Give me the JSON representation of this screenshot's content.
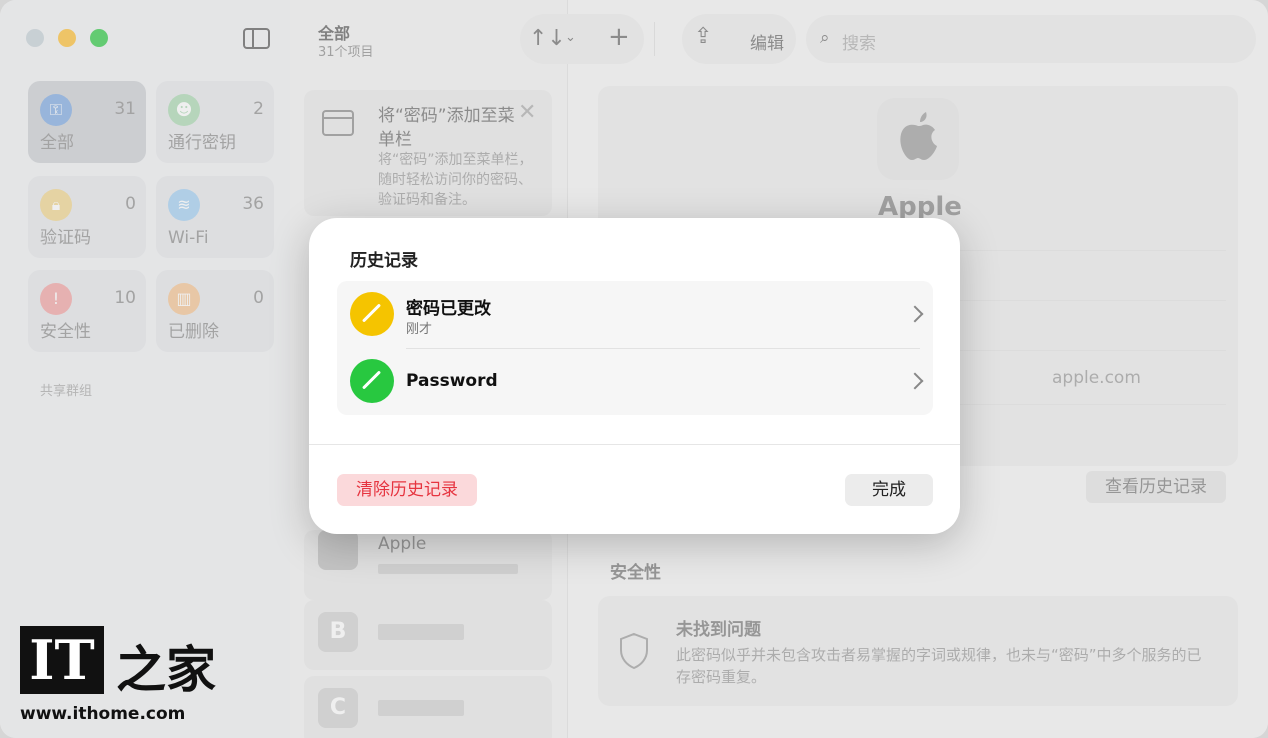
{
  "sidebar": {
    "tiles": [
      {
        "label": "全部",
        "count": "31",
        "color": "#1a73e8"
      },
      {
        "label": "通行密钥",
        "count": "2",
        "color": "#34c759"
      },
      {
        "label": "验证码",
        "count": "0",
        "color": "#f5b400"
      },
      {
        "label": "Wi-Fi",
        "count": "36",
        "color": "#2f9bf5"
      },
      {
        "label": "安全性",
        "count": "10",
        "color": "#ff3b30"
      },
      {
        "label": "已删除",
        "count": "0",
        "color": "#ff9500"
      }
    ],
    "section_label": "共享群组"
  },
  "list": {
    "title": "全部",
    "subtitle": "31个项目",
    "promo_title": "将“密码”添加至菜单栏",
    "promo_body": "将“密码”添加至菜单栏，随时轻松访问你的密码、验证码和备注。",
    "items": [
      {
        "name": "Apple"
      },
      {
        "name": "B"
      },
      {
        "name": "C"
      }
    ]
  },
  "toolbar": {
    "sort_icon": "↑↓",
    "add_icon": "+",
    "edit_label": "编辑",
    "search_placeholder": "搜索"
  },
  "detail": {
    "app_name": "Apple",
    "website": "apple.com",
    "history_button": "查看历史记录",
    "security_label": "安全性",
    "security_title": "未找到问题",
    "security_body": "此密码似乎并未包含攻击者易掌握的字词或规律，也未与“密码”中多个服务的已存密码重复。"
  },
  "modal": {
    "title": "历史记录",
    "rows": [
      {
        "title": "密码已更改",
        "subtitle": "刚才",
        "icon_color": "#f5c400"
      },
      {
        "title": "Password",
        "subtitle": "",
        "icon_color": "#28c840"
      }
    ],
    "clear_button": "清除历史记录",
    "done_button": "完成"
  },
  "watermark": {
    "logo": "IT",
    "logo_cn": "之家",
    "url": "www.ithome.com"
  }
}
